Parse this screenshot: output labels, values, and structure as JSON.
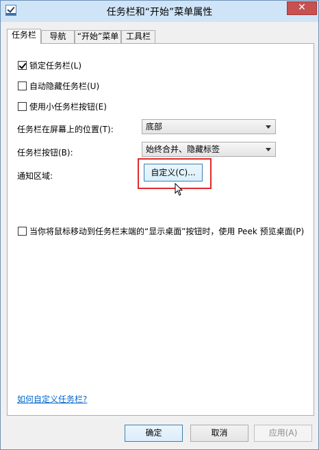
{
  "window": {
    "title": "任务栏和“开始”菜单属性",
    "close_glyph": "✕"
  },
  "tabs": [
    {
      "label": "任务栏",
      "active": true
    },
    {
      "label": "导航",
      "active": false
    },
    {
      "label": "“开始”菜单",
      "active": false
    },
    {
      "label": "工具栏",
      "active": false
    }
  ],
  "taskbar": {
    "lock": {
      "label": "锁定任务栏(L)",
      "checked": true
    },
    "autohide": {
      "label": "自动隐藏任务栏(U)",
      "checked": false
    },
    "small_buttons": {
      "label": "使用小任务栏按钮(E)",
      "checked": false
    },
    "position_label": "任务栏在屏幕上的位置(T):",
    "position_value": "底部",
    "buttons_label": "任务栏按钮(B):",
    "buttons_value": "始终合并、隐藏标签",
    "notification_label": "通知区域:",
    "customize_label": "自定义(C)...",
    "peek": {
      "label": "当你将鼠标移动到任务栏末端的“显示桌面”按钮时，使用 Peek 预览桌面(P)",
      "checked": false
    },
    "help_link": "如何自定义任务栏?"
  },
  "buttons": {
    "ok": "确定",
    "cancel": "取消",
    "apply": "应用(A)"
  },
  "colors": {
    "highlight": "#e0282a",
    "link": "#0066cc",
    "titlebar": "#cfe4f7",
    "close": "#c75050"
  }
}
